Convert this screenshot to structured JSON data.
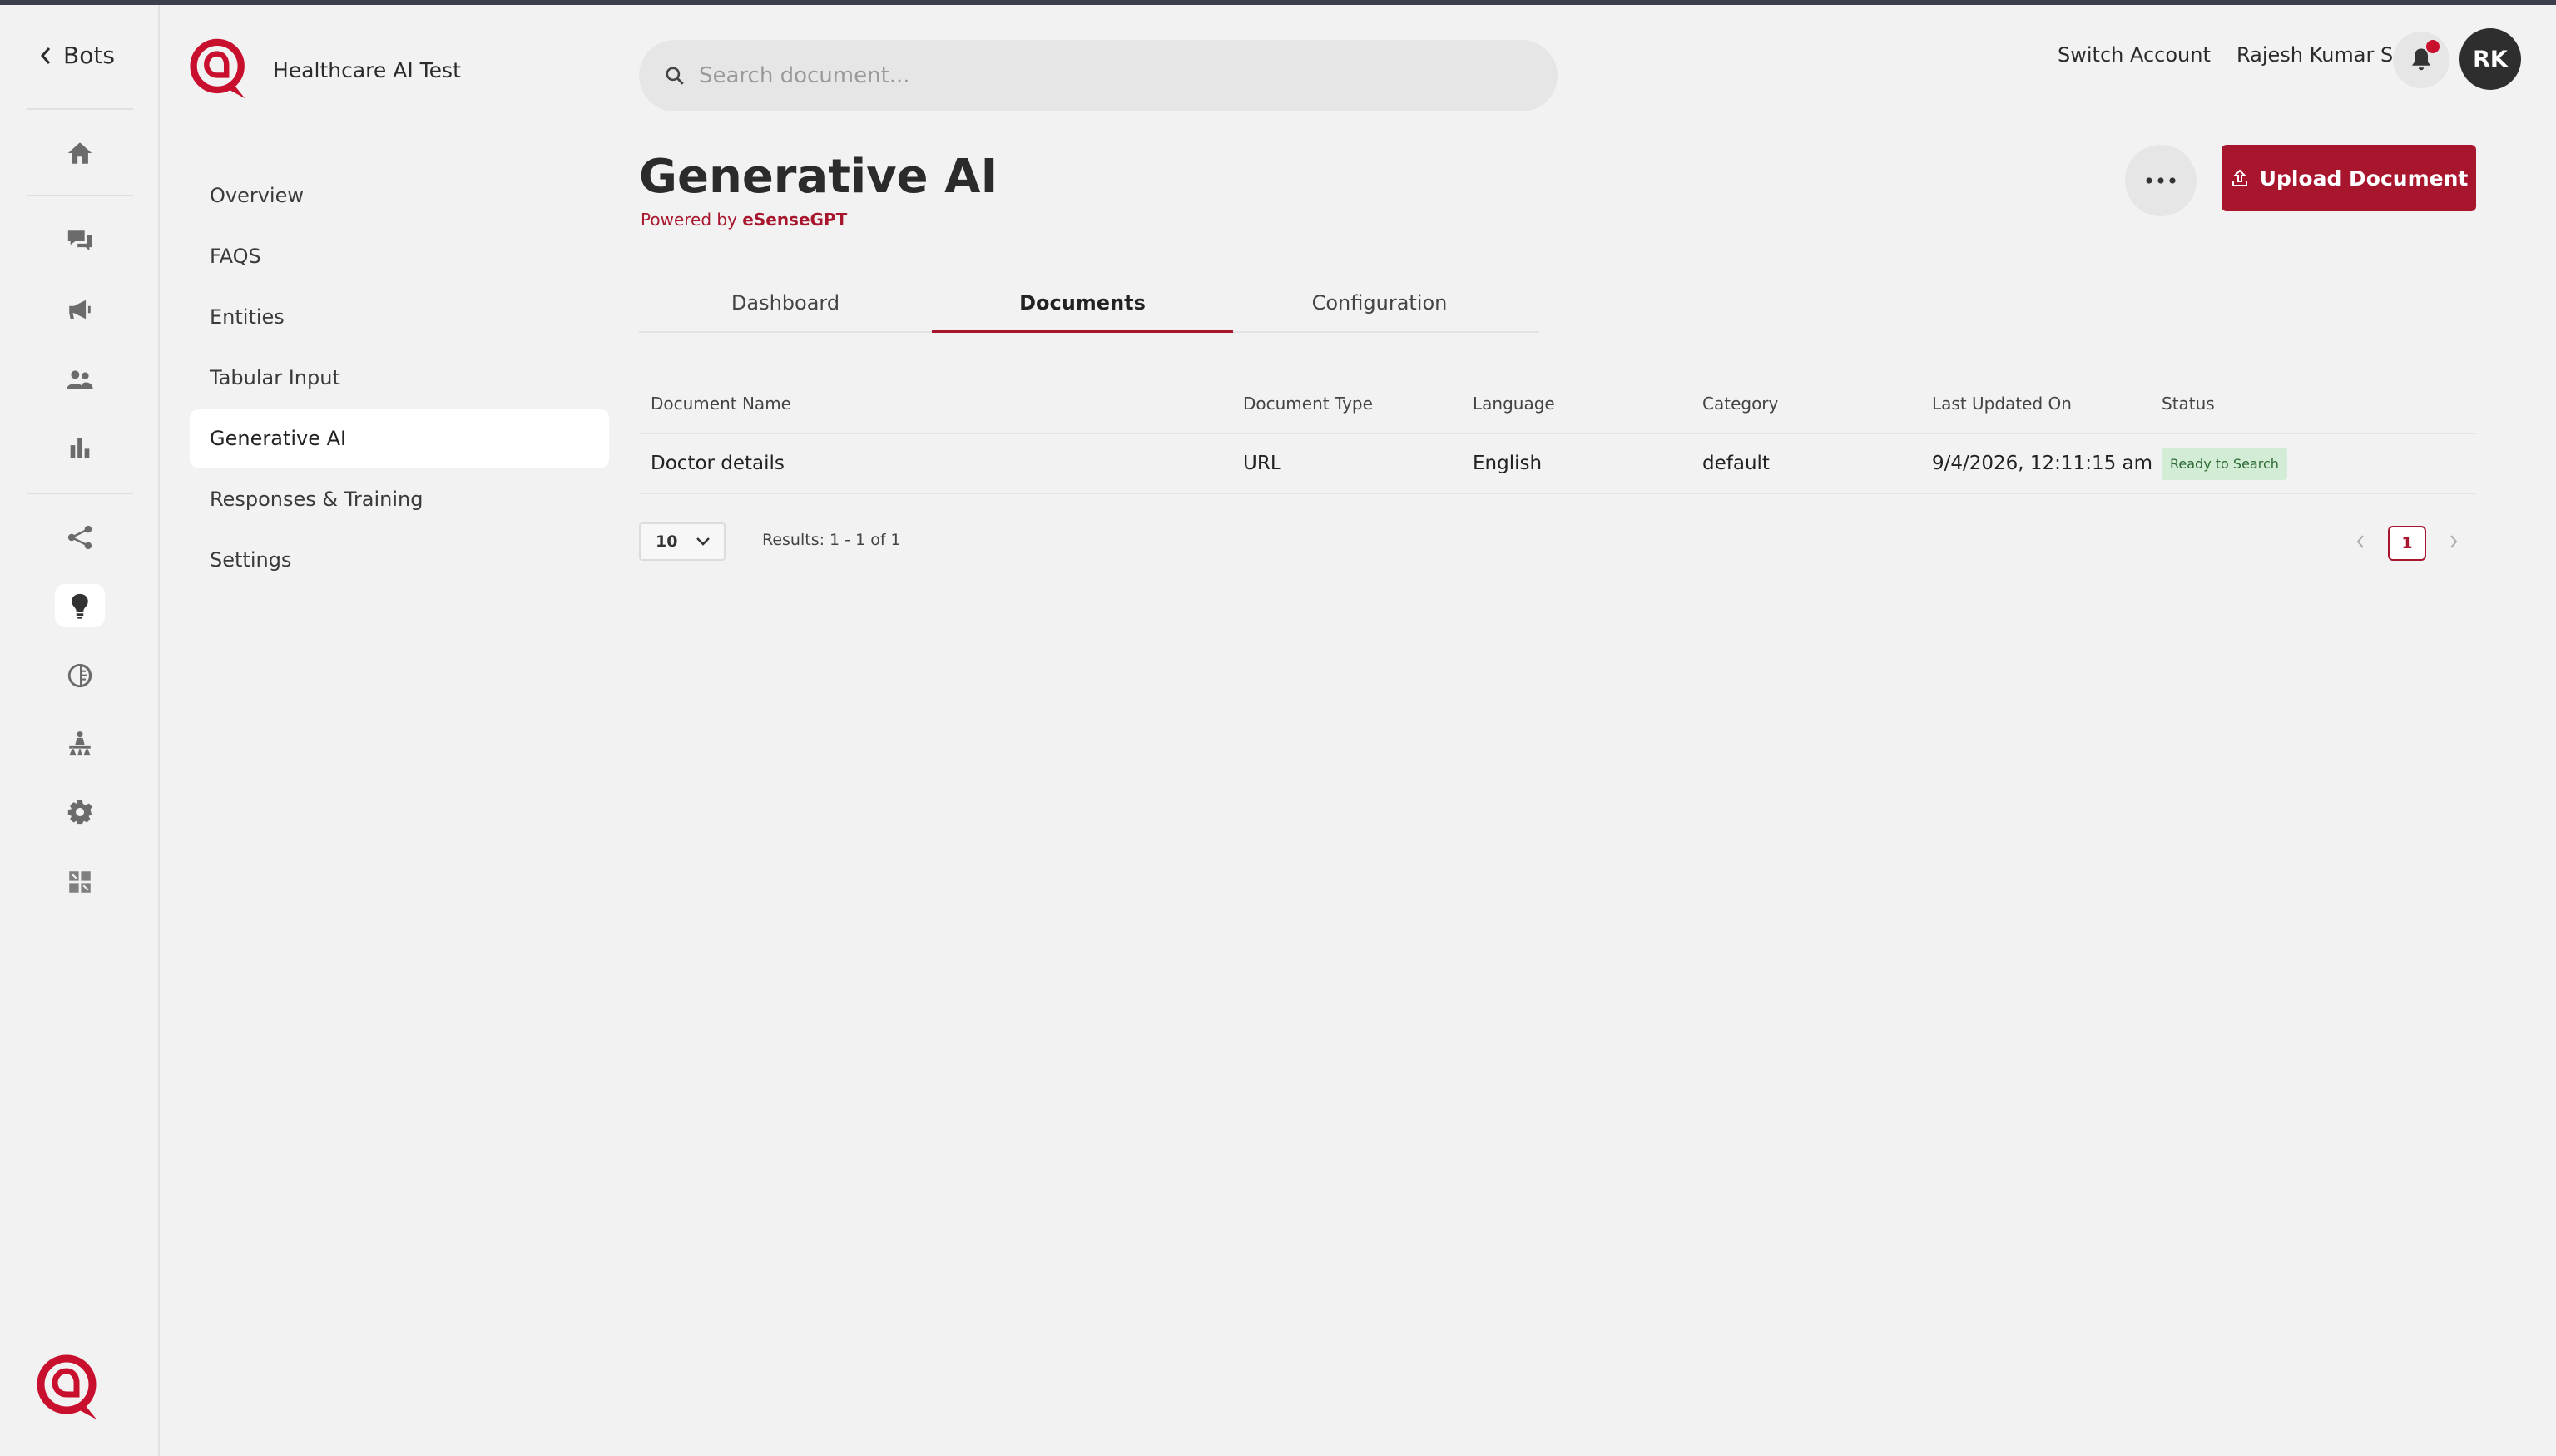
{
  "nav": {
    "back_label": "Bots"
  },
  "bot": {
    "name": "Healthcare AI Test"
  },
  "rail": {
    "icons": [
      "home-icon",
      "chat-icon",
      "megaphone-icon",
      "users-icon",
      "bar-chart-icon",
      "flow-icon",
      "bulb-icon",
      "brain-icon",
      "hierarchy-icon",
      "gear-icon",
      "puzzle-icon"
    ],
    "active": "bulb-icon"
  },
  "subnav": {
    "items": [
      {
        "label": "Overview"
      },
      {
        "label": "FAQS"
      },
      {
        "label": "Entities"
      },
      {
        "label": "Tabular Input"
      },
      {
        "label": "Generative AI"
      },
      {
        "label": "Responses & Training"
      },
      {
        "label": "Settings"
      }
    ],
    "active_index": 4
  },
  "search": {
    "placeholder": "Search document...",
    "value": ""
  },
  "header": {
    "switch_account": "Switch Account",
    "user_name": "Rajesh Kumar S",
    "avatar_initials": "RK"
  },
  "page": {
    "title": "Generative AI",
    "powered_prefix": "Powered by",
    "powered_brand": "eSenseGPT",
    "upload_label": "Upload Document"
  },
  "tabs": [
    {
      "label": "Dashboard"
    },
    {
      "label": "Documents"
    },
    {
      "label": "Configuration"
    }
  ],
  "active_tab": 1,
  "table": {
    "columns": [
      "Document Name",
      "Document Type",
      "Language",
      "Category",
      "Last Updated On",
      "Status"
    ],
    "rows": [
      {
        "name": "Doctor details",
        "type": "URL",
        "language": "English",
        "category": "default",
        "updated": "9/4/2026, 12:11:15 am",
        "status": "Ready to Search"
      }
    ]
  },
  "pagination": {
    "page_size": "10",
    "results_text": "Results: 1 - 1 of 1",
    "current_page": "1"
  },
  "colors": {
    "brand": "#a8162e",
    "status_bg": "#d3ecd5",
    "status_text": "#2d6a34"
  }
}
